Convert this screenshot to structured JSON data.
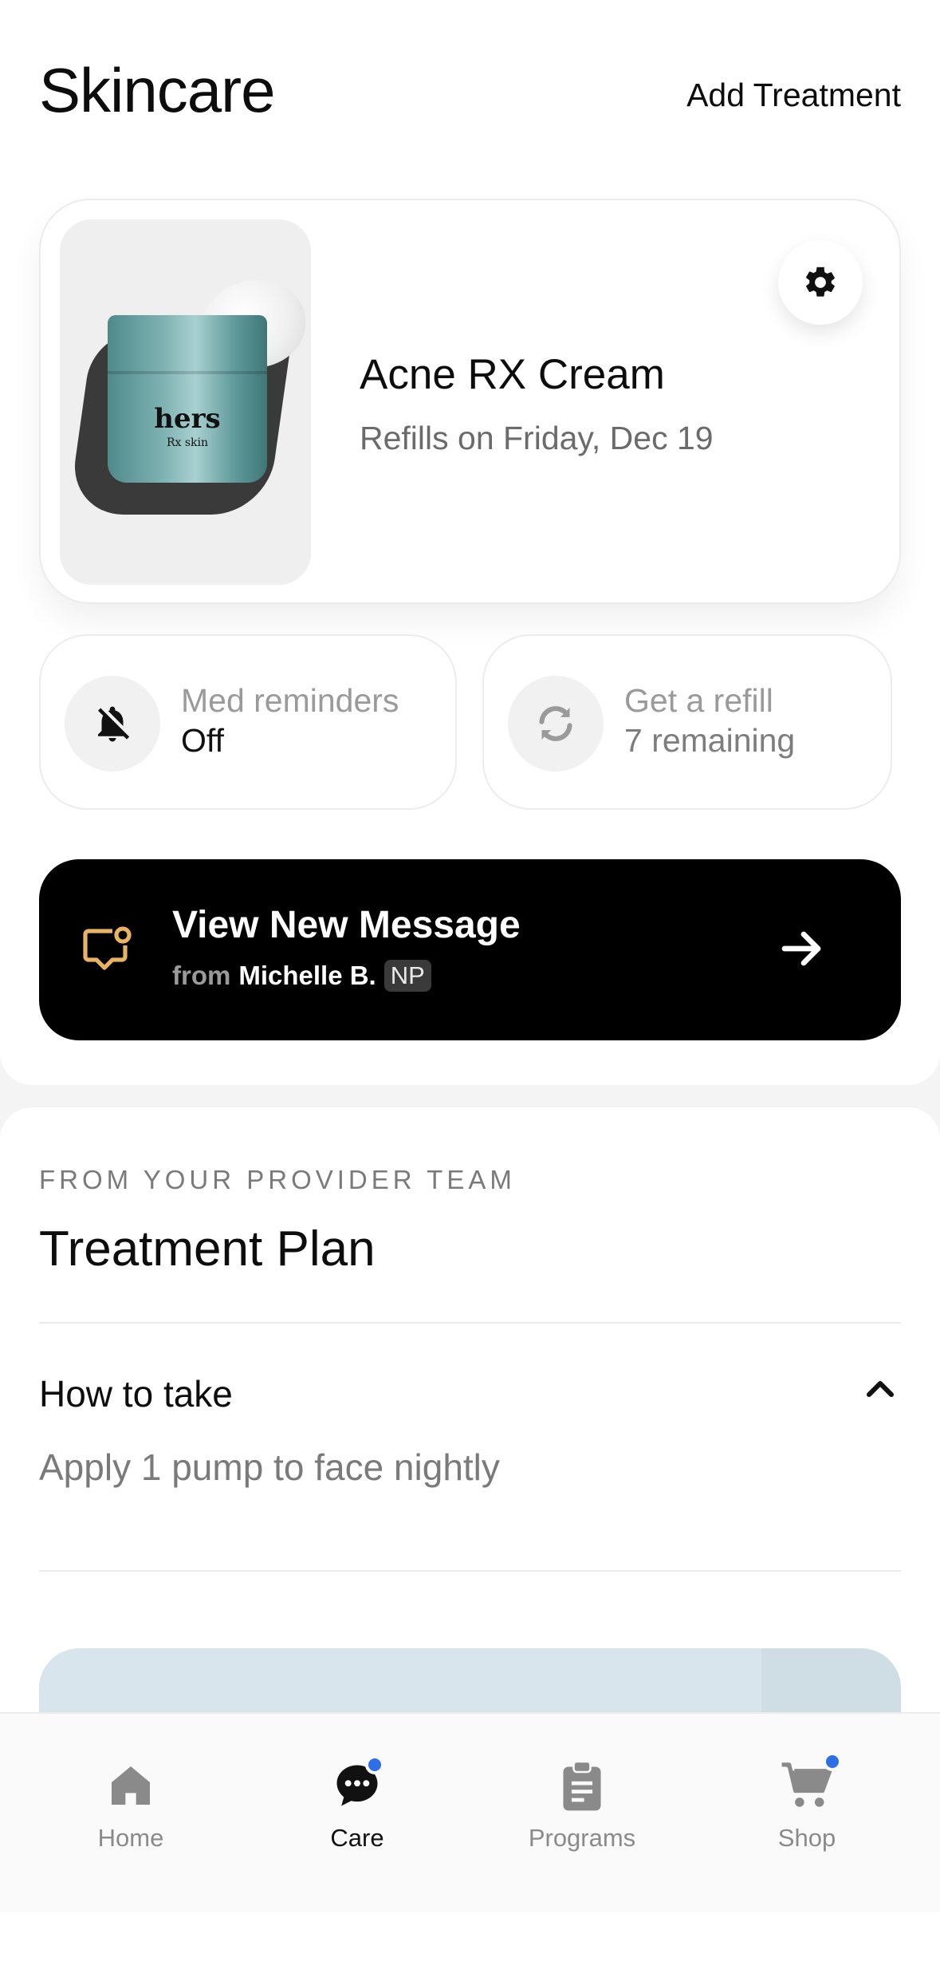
{
  "header": {
    "title": "Skincare",
    "add_treatment_label": "Add Treatment"
  },
  "product": {
    "name": "Acne RX Cream",
    "refill_text": "Refills on Friday, Dec 19",
    "image": {
      "brand": "hers",
      "sub": "Rx skin"
    }
  },
  "reminders_card": {
    "label": "Med reminders",
    "value": "Off",
    "icon": "bell-off-icon"
  },
  "refill_card": {
    "label": "Get a refill",
    "value": "7 remaining",
    "icon": "refresh-icon"
  },
  "message": {
    "title": "View New Message",
    "from_word": "from",
    "sender": "Michelle B.",
    "badge": "NP",
    "accent": "#e8b464"
  },
  "treatment_plan": {
    "eyebrow": "FROM YOUR PROVIDER TEAM",
    "title": "Treatment Plan",
    "how_to_take": {
      "title": "How to take",
      "body": "Apply 1 pump to face nightly",
      "expanded": true
    }
  },
  "bottom_nav": {
    "items": [
      {
        "label": "Home",
        "icon": "home-icon",
        "active": false,
        "badge": false
      },
      {
        "label": "Care",
        "icon": "chat-icon",
        "active": true,
        "badge": true
      },
      {
        "label": "Programs",
        "icon": "clipboard-icon",
        "active": false,
        "badge": false
      },
      {
        "label": "Shop",
        "icon": "cart-icon",
        "active": false,
        "badge": true
      }
    ],
    "badge_color": "#2e6fe6"
  }
}
